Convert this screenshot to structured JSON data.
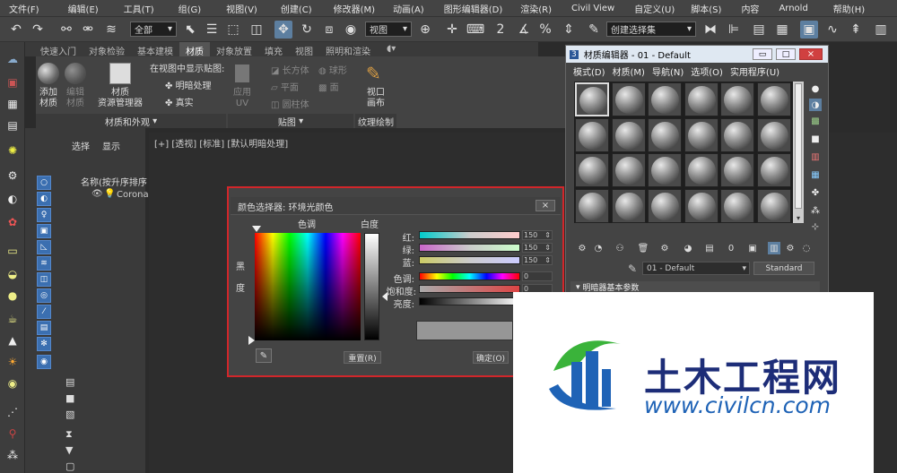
{
  "menubar": {
    "items": [
      "文件(F)",
      "编辑(E)",
      "工具(T)",
      "组(G)",
      "视图(V)",
      "创建(C)",
      "修改器(M)",
      "动画(A)",
      "图形编辑器(D)",
      "渲染(R)",
      "Civil View",
      "自定义(U)",
      "脚本(S)",
      "内容",
      "Arnold",
      "帮助(H)"
    ]
  },
  "toolbar": {
    "selection_filter": "全部",
    "ref_coord": "视图",
    "named_selection": "创建选择集"
  },
  "ribbon": {
    "tabs": [
      "快速入门",
      "对象检验",
      "基本建模",
      "材质",
      "对象放置",
      "填充",
      "视图",
      "照明和渲染"
    ],
    "active_tab": "材质",
    "add_material": "添加\n材质",
    "edit_material": "编辑\n材质",
    "material_browser": "材质\n资源管理器",
    "show_in_viewport": "在视图中显示贴图:",
    "shaded": "明暗处理",
    "realistic": "真实",
    "apply_uv": "应用\nUV",
    "box": "长方体",
    "sphere": "球形",
    "plane": "平面",
    "face": "面",
    "cylinder": "圆柱体",
    "viewport_canvas": "视口\n画布",
    "group_materials": "材质和外观",
    "group_mapping": "贴图",
    "group_texture": "纹理绘制"
  },
  "explorer": {
    "tab_select": "选择",
    "tab_display": "显示",
    "column_header": "名称(按升序排序",
    "item": "Coronal"
  },
  "viewport": {
    "label": "[+] [透视] [标准] [默认明暗处理]"
  },
  "color_picker": {
    "title": "颜色选择器: 环境光颜色",
    "hue_label": "色调",
    "white_label": "白度",
    "black_label": "黑\n\n度",
    "red_label": "红:",
    "green_label": "绿:",
    "blue_label": "蓝:",
    "hue2_label": "色调:",
    "saturation_label": "饱和度:",
    "value_label": "亮度:",
    "red": "150",
    "green": "150",
    "blue": "150",
    "hue": "0",
    "saturation": "0",
    "reset": "重置(R)",
    "ok": "确定(O)",
    "close": "×"
  },
  "material_editor": {
    "title": "材质编辑器 - 01 - Default",
    "menus": [
      "模式(D)",
      "材质(M)",
      "导航(N)",
      "选项(O)",
      "实用程序(U)"
    ],
    "material_name": "01 - Default",
    "material_type": "Standard",
    "rollout": "明暗器基本参数"
  },
  "watermark": {
    "logo_text": "土木工程网",
    "url": "www.civilcn.com"
  }
}
